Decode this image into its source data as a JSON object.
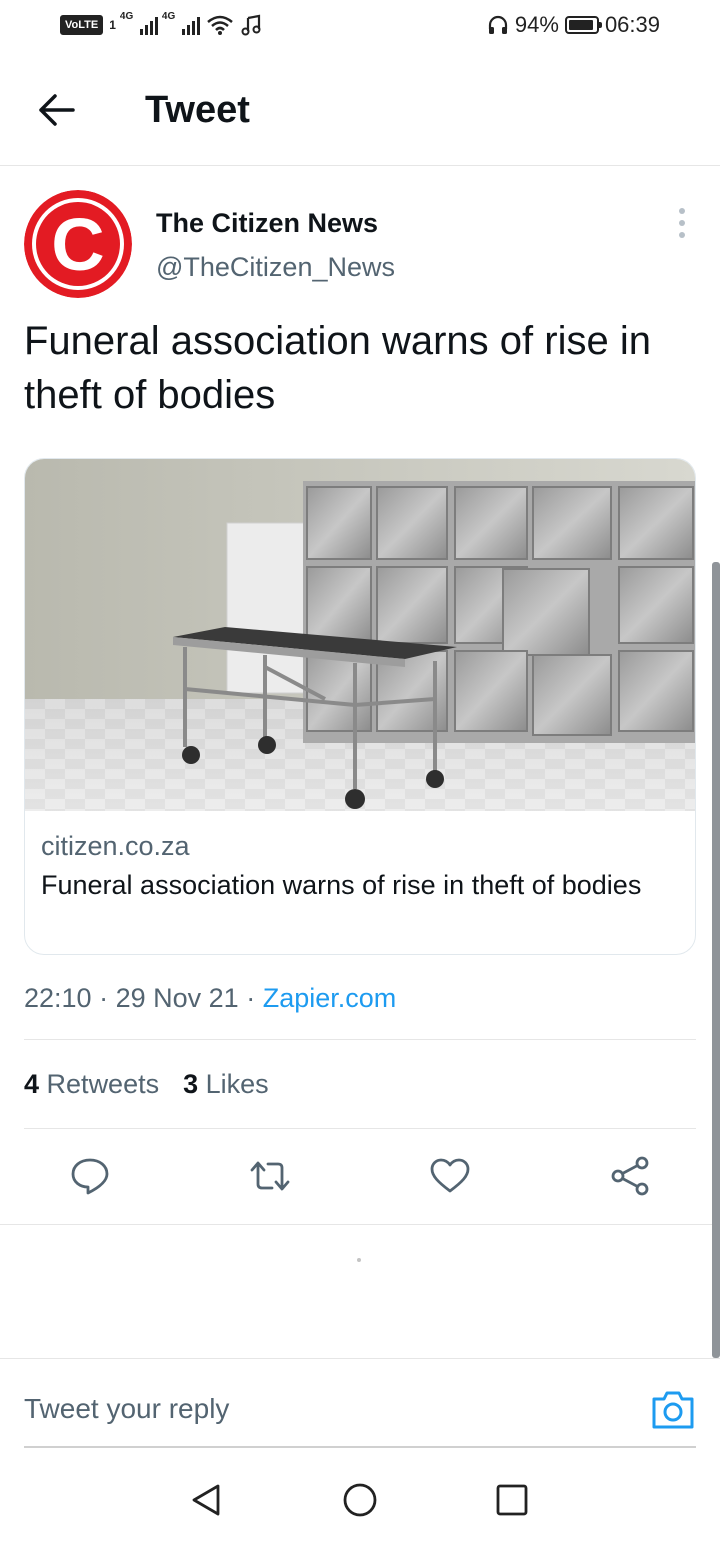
{
  "status_bar": {
    "volte": "VoLTE",
    "sim": "1",
    "net1": "4G",
    "net2": "4G",
    "battery_pct": "94%",
    "battery_level": 0.94,
    "time": "06:39"
  },
  "header": {
    "title": "Tweet"
  },
  "tweet": {
    "author_name": "The Citizen News",
    "author_handle": "@TheCitizen_News",
    "avatar_letter": "C",
    "text": "Funeral association warns of rise in theft of bodies",
    "card": {
      "domain": "citizen.co.za",
      "title": "Funeral association warns of rise in theft of bodies"
    },
    "time": "22:10",
    "date": "29 Nov 21",
    "via": "Zapier.com",
    "sep": "·",
    "retweets_count": "4",
    "retweets_label": "Retweets",
    "likes_count": "3",
    "likes_label": "Likes"
  },
  "reply": {
    "placeholder": "Tweet your reply"
  },
  "colors": {
    "accent": "#1d9bf0",
    "brand_red": "#e31b23"
  }
}
